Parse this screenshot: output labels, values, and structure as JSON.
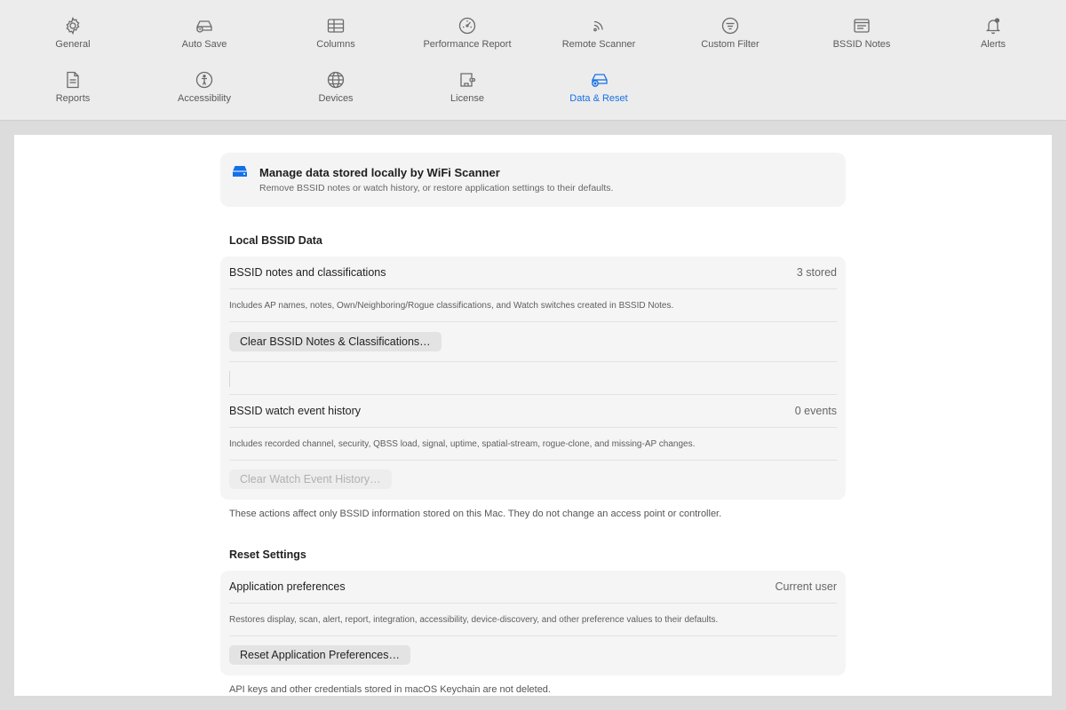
{
  "toolbar": {
    "items": [
      {
        "label": "General",
        "icon": "gear-icon"
      },
      {
        "label": "Auto Save",
        "icon": "drive-clock-icon"
      },
      {
        "label": "Columns",
        "icon": "table-icon"
      },
      {
        "label": "Performance Report",
        "icon": "gauge-icon"
      },
      {
        "label": "Remote Scanner",
        "icon": "rss-icon"
      },
      {
        "label": "Custom Filter",
        "icon": "filter-icon"
      },
      {
        "label": "BSSID Notes",
        "icon": "note-icon"
      },
      {
        "label": "Alerts",
        "icon": "bell-icon"
      },
      {
        "label": "Reports",
        "icon": "document-icon"
      },
      {
        "label": "Accessibility",
        "icon": "accessibility-icon"
      },
      {
        "label": "Devices",
        "icon": "globe-icon"
      },
      {
        "label": "License",
        "icon": "license-icon"
      },
      {
        "label": "Data & Reset",
        "icon": "drive-reset-icon"
      }
    ],
    "active_index": 12,
    "accent_color": "#1570e8"
  },
  "banner": {
    "title": "Manage data stored locally by WiFi Scanner",
    "subtitle": "Remove BSSID notes or watch history, or restore application settings to their defaults."
  },
  "local_data": {
    "title": "Local BSSID Data",
    "notes_label": "BSSID notes and classifications",
    "notes_value": "3 stored",
    "notes_desc": "Includes AP names, notes, Own/Neighboring/Rogue classifications, and Watch switches created in BSSID Notes.",
    "clear_notes_button": "Clear BSSID Notes & Classifications…",
    "history_label": "BSSID watch event history",
    "history_value": "0 events",
    "history_desc": "Includes recorded channel, security, QBSS load, signal, uptime, spatial-stream, rogue-clone, and missing-AP changes.",
    "clear_history_button": "Clear Watch Event History…",
    "footnote": "These actions affect only BSSID information stored on this Mac. They do not change an access point or controller."
  },
  "reset": {
    "title": "Reset Settings",
    "prefs_label": "Application preferences",
    "prefs_value": "Current user",
    "prefs_desc": "Restores display, scan, alert, report, integration, accessibility, device-discovery, and other preference values to their defaults.",
    "reset_button": "Reset Application Preferences…",
    "footnote": "API keys and other credentials stored in macOS Keychain are not deleted."
  }
}
